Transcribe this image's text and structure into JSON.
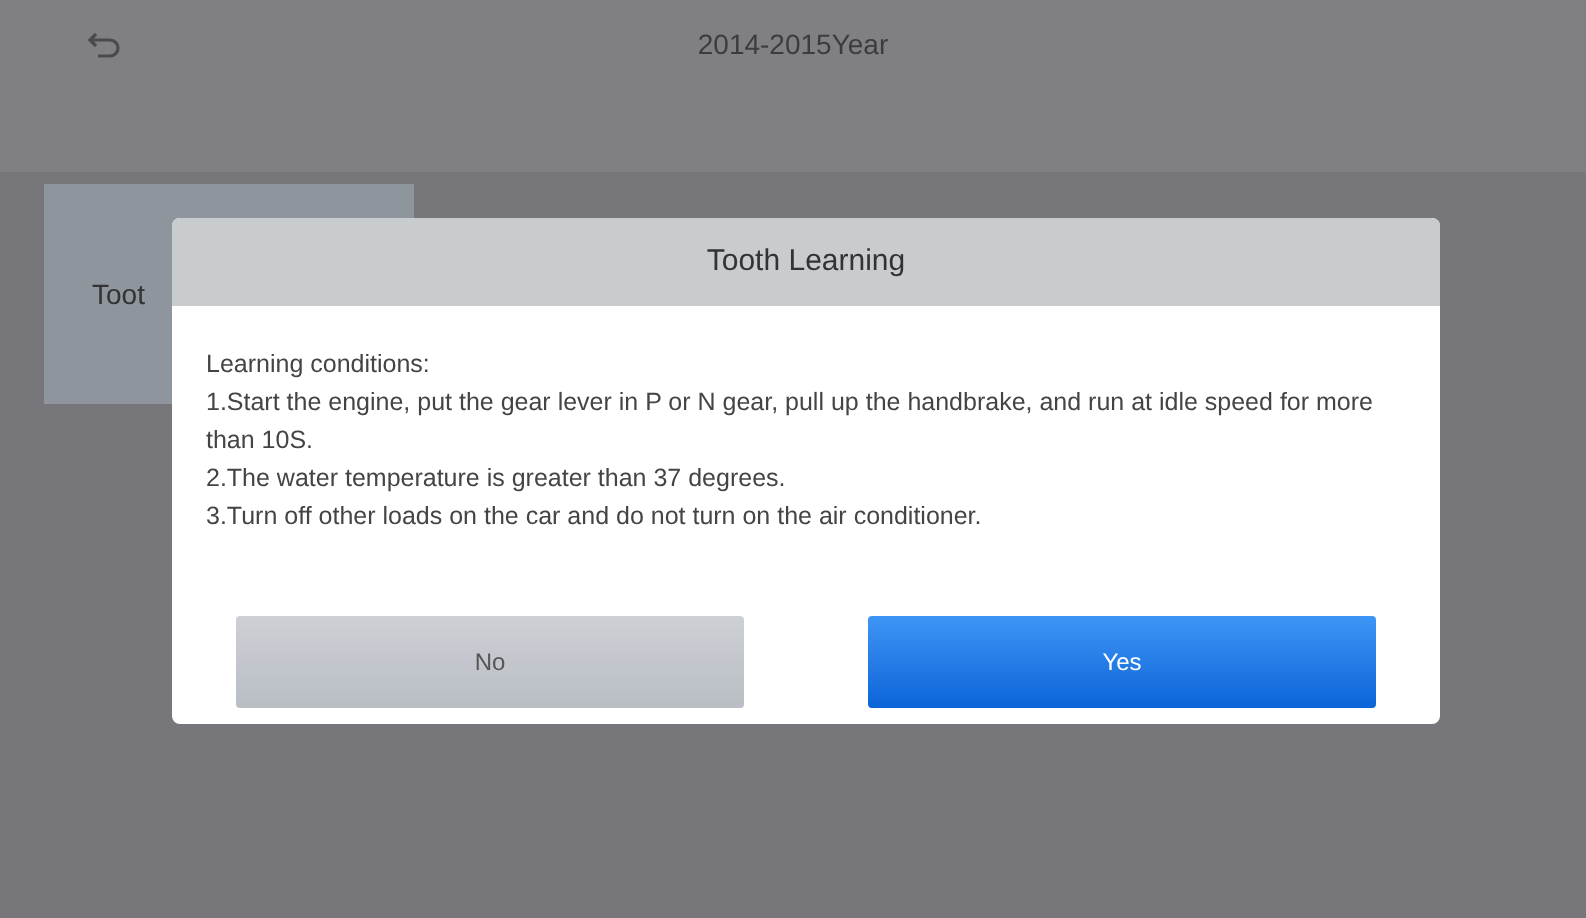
{
  "header": {
    "title": "2014-2015Year"
  },
  "function_cards": [
    {
      "label": "Toot"
    }
  ],
  "dialog": {
    "title": "Tooth Learning",
    "lines": [
      "Learning conditions:",
      "1.Start the engine, put the gear lever in P or N gear, pull up the handbrake, and run at idle speed for more than 10S.",
      "2.The water temperature is greater than 37 degrees.",
      "3.Turn off other loads on the car and do not turn on the air conditioner."
    ],
    "buttons": [
      {
        "label": "No",
        "kind": "secondary"
      },
      {
        "label": "Yes",
        "kind": "primary"
      }
    ]
  }
}
